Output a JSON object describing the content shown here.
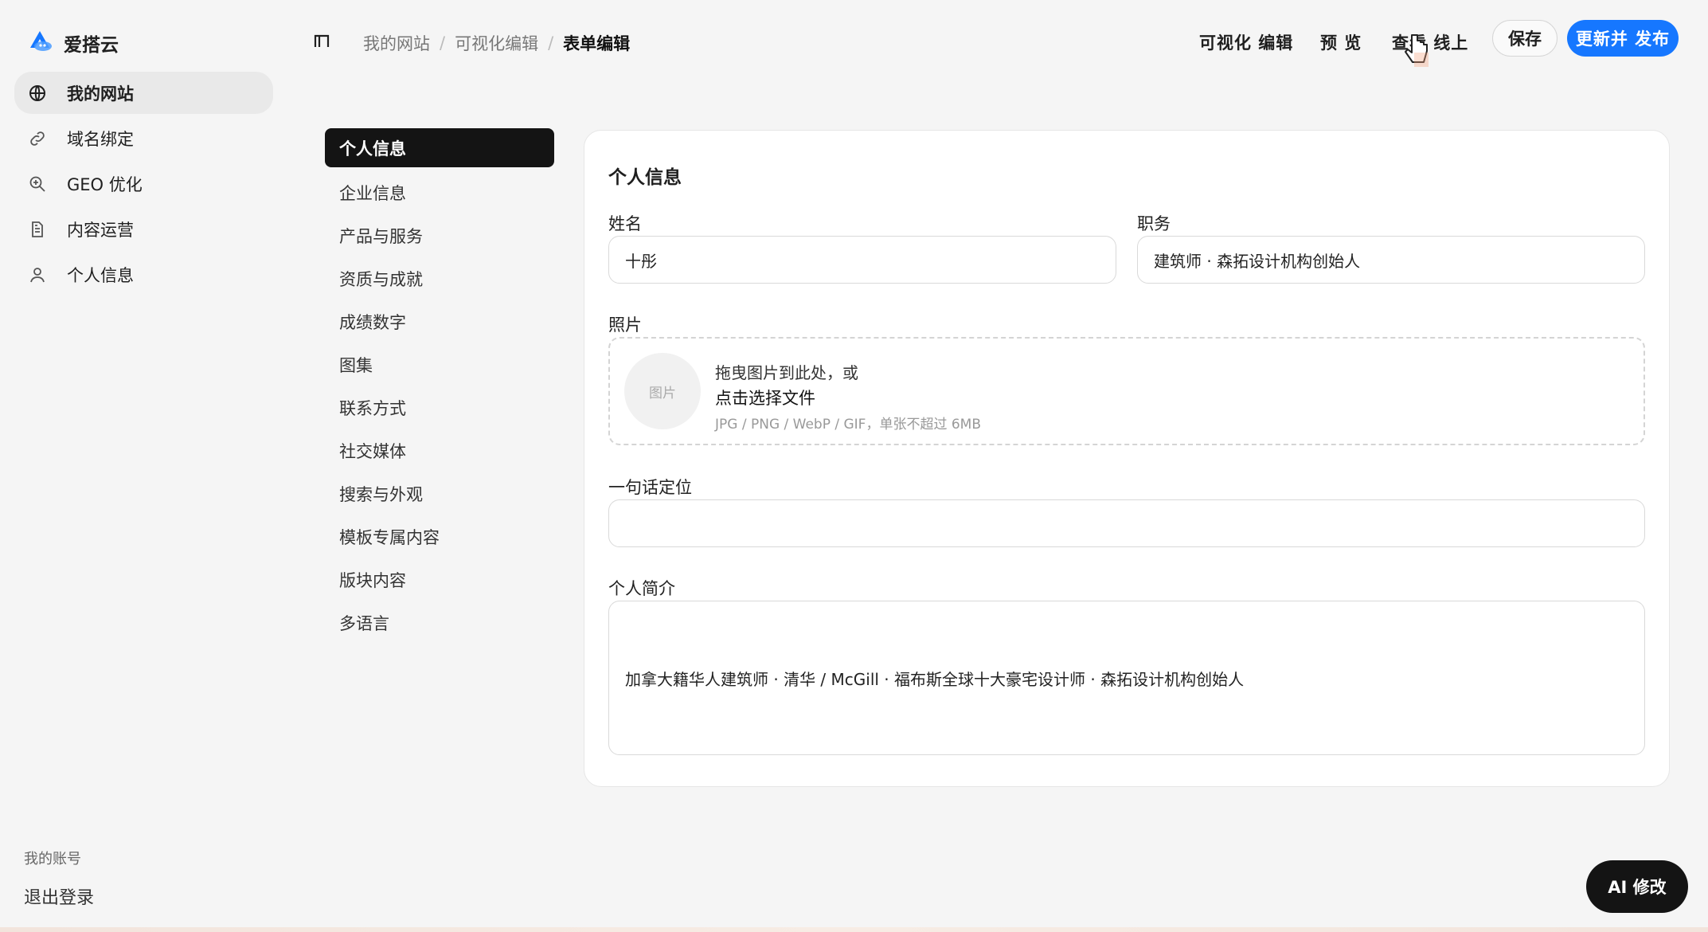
{
  "brand": {
    "name": "爱搭云",
    "color": "#1677ff"
  },
  "sidebar": {
    "items": [
      {
        "label": "我的网站",
        "icon": "globe-icon",
        "active": true
      },
      {
        "label": "域名绑定",
        "icon": "link-icon",
        "active": false
      },
      {
        "label": "GEO 优化",
        "icon": "zoom-in-icon",
        "active": false
      },
      {
        "label": "内容运营",
        "icon": "document-icon",
        "active": false
      },
      {
        "label": "个人信息",
        "icon": "user-icon",
        "active": false
      }
    ],
    "account_label": "我的账号",
    "logout_label": "退出登录"
  },
  "topbar": {
    "breadcrumb": [
      "我的网站",
      "可视化编辑",
      "表单编辑"
    ],
    "visual_edit": "可视化 编辑",
    "preview": "预 览",
    "view_online": "查看 线上",
    "save": "保存",
    "publish": "更新并 发布"
  },
  "sections": {
    "items": [
      "个人信息",
      "企业信息",
      "产品与服务",
      "资质与成就",
      "成绩数字",
      "图集",
      "联系方式",
      "社交媒体",
      "搜索与外观",
      "模板专属内容",
      "版块内容",
      "多语言"
    ],
    "active": "个人信息"
  },
  "form": {
    "title": "个人信息",
    "name_label": "姓名",
    "name_value": "十彤",
    "role_label": "职务",
    "role_value": "建筑师 · 森拓设计机构创始人",
    "photo_label": "照片",
    "photo_placeholder": "图片",
    "drag_text": "拖曳图片到此处，或",
    "choose_text": "点击选择文件",
    "hint_text": "JPG / PNG / WebP / GIF，单张不超过 6MB",
    "tagline_label": "一句话定位",
    "tagline_value": "",
    "bio_label": "个人简介",
    "bio_value": "加拿大籍华人建筑师 · 清华 / McGill · 福布斯全球十大豪宅设计师 · 森拓设计机构创始人"
  },
  "ai_button": "AI 修改"
}
